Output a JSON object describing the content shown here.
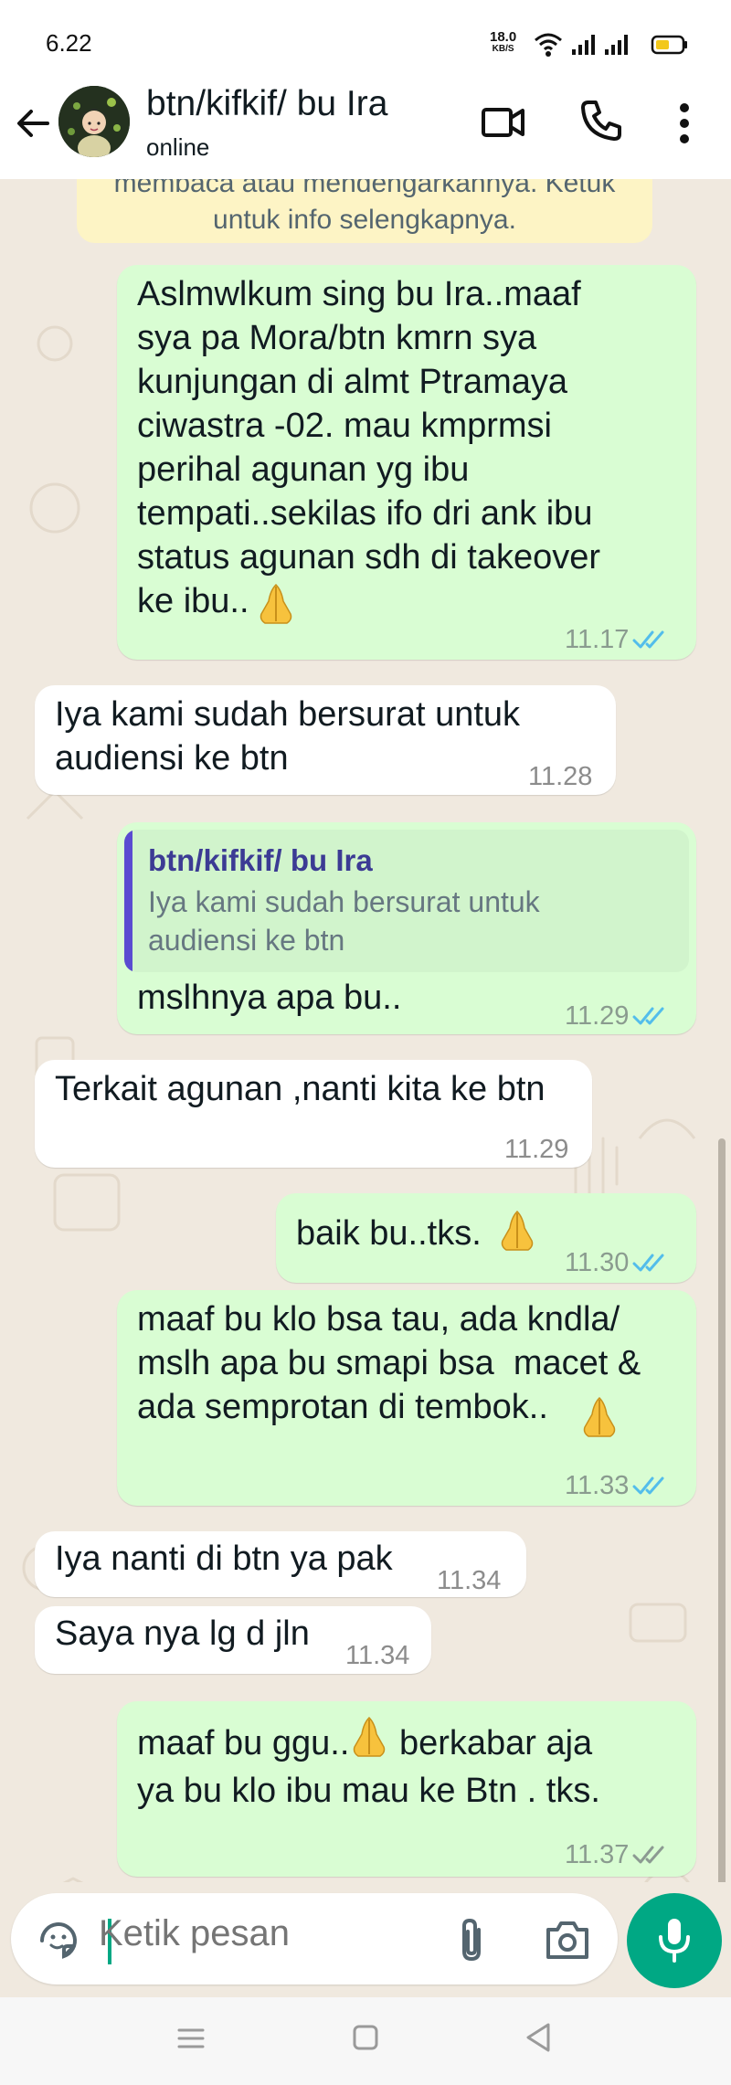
{
  "status_bar": {
    "time": "6.22",
    "net_speed_value": "18.0",
    "net_speed_unit": "KB/S",
    "icons": [
      "wifi-icon",
      "signal-icon",
      "signal-icon",
      "battery-icon"
    ]
  },
  "header": {
    "contact_name": "btn/kifkif/ bu Ira",
    "status": "online",
    "icons": [
      "back-arrow-icon",
      "avatar",
      "video-call-icon",
      "voice-call-icon",
      "more-options-icon"
    ]
  },
  "chat": {
    "info_banner": {
      "line1": "membaca atau mendengarkannya. Ketuk",
      "line2": "untuk info selengkapnya."
    },
    "messages": [
      {
        "direction": "out",
        "text": "Aslmwlkum sing bu Ira..maaf\nsya pa Mora/btn kmrn sya\nkunjungan di almt Ptramaya\nciwastra -02. mau kmprmsi\nperihal agunan yg ibu\ntempati..sekilas ifo dri ank ibu\nstatus agunan sdh di takeover\nke ibu..",
        "emoji": "folded-hands-emoji",
        "time": "11.17",
        "status": "read"
      },
      {
        "direction": "in",
        "text": "Iya kami sudah bersurat untuk\naudiensi ke btn",
        "time": "11.28"
      },
      {
        "direction": "out",
        "quote_name": "btn/kifkif/ bu Ira",
        "quote_text": "Iya kami sudah bersurat untuk\naudiensi ke btn",
        "text": "mslhnya apa bu..",
        "time": "11.29",
        "status": "read"
      },
      {
        "direction": "in",
        "text": "Terkait agunan ,nanti kita ke btn",
        "time": "11.29"
      },
      {
        "direction": "out",
        "text": "baik bu..tks.",
        "emoji": "folded-hands-emoji",
        "time": "11.30",
        "status": "read"
      },
      {
        "direction": "out",
        "text": "maaf bu klo bsa tau, ada kndla/\nmslh apa bu smapi bsa  macet &\nada semprotan di tembok..",
        "emoji": "folded-hands-emoji",
        "time": "11.33",
        "status": "read"
      },
      {
        "direction": "in",
        "text": "Iya nanti di btn ya pak",
        "time": "11.34"
      },
      {
        "direction": "in",
        "text": "Saya nya lg d jln",
        "time": "11.34"
      },
      {
        "direction": "out",
        "text_before_emoji": "maaf bu ggu..",
        "text_after_emoji": " berkabar aja",
        "text_line2": "ya bu klo ibu mau ke Btn . tks.",
        "emoji": "folded-hands-emoji",
        "time": "11.37",
        "status": "delivered"
      }
    ]
  },
  "input_bar": {
    "placeholder": "Ketik pesan",
    "icons": [
      "sticker-icon",
      "attach-icon",
      "camera-icon",
      "mic-icon"
    ]
  },
  "nav_bar": {
    "icons": [
      "recent-apps-icon",
      "home-icon",
      "back-icon"
    ]
  },
  "colors": {
    "outgoing_bubble": "#d9fdd3",
    "incoming_bubble": "#ffffff",
    "accent": "#00a884",
    "read_ticks": "#53bdeb",
    "chat_background": "#f0e9df"
  }
}
